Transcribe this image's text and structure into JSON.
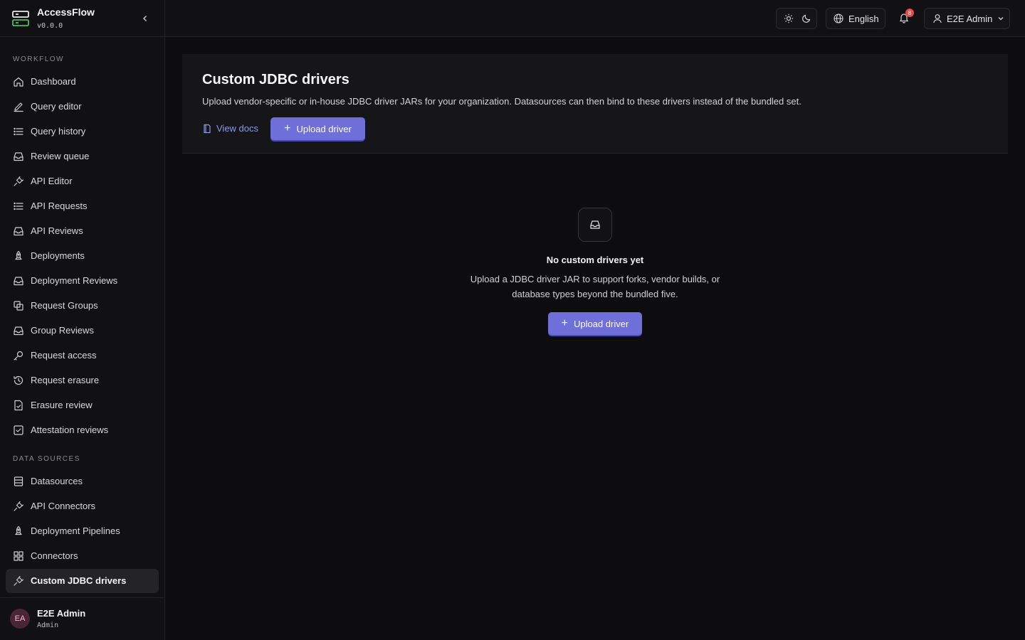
{
  "app": {
    "name": "AccessFlow",
    "version": "v0.0.0"
  },
  "sidebar": {
    "sections": [
      {
        "label": "WORKFLOW",
        "items": [
          {
            "label": "Dashboard",
            "icon": "home-icon"
          },
          {
            "label": "Query editor",
            "icon": "pencil-icon"
          },
          {
            "label": "Query history",
            "icon": "list-icon"
          },
          {
            "label": "Review queue",
            "icon": "inbox-icon"
          },
          {
            "label": "API Editor",
            "icon": "plug-icon"
          },
          {
            "label": "API Requests",
            "icon": "list-icon"
          },
          {
            "label": "API Reviews",
            "icon": "inbox-icon"
          },
          {
            "label": "Deployments",
            "icon": "rocket-icon"
          },
          {
            "label": "Deployment Reviews",
            "icon": "inbox-icon"
          },
          {
            "label": "Request Groups",
            "icon": "layers-icon"
          },
          {
            "label": "Group Reviews",
            "icon": "inbox-icon"
          },
          {
            "label": "Request access",
            "icon": "key-icon"
          },
          {
            "label": "Request erasure",
            "icon": "history-icon"
          },
          {
            "label": "Erasure review",
            "icon": "file-check-icon"
          },
          {
            "label": "Attestation reviews",
            "icon": "checkbox-icon"
          }
        ]
      },
      {
        "label": "DATA SOURCES",
        "items": [
          {
            "label": "Datasources",
            "icon": "database-icon"
          },
          {
            "label": "API Connectors",
            "icon": "plug-icon"
          },
          {
            "label": "Deployment Pipelines",
            "icon": "rocket-icon"
          },
          {
            "label": "Connectors",
            "icon": "grid-icon"
          },
          {
            "label": "Custom JDBC drivers",
            "icon": "plug-icon",
            "active": true
          }
        ]
      }
    ],
    "user": {
      "initials": "EA",
      "name": "E2E Admin",
      "role": "Admin"
    }
  },
  "header": {
    "language": "English",
    "notification_count": "8",
    "user_name": "E2E Admin"
  },
  "main": {
    "title": "Custom JDBC drivers",
    "description": "Upload vendor-specific or in-house JDBC driver JARs for your organization. Datasources can then bind to these drivers instead of the bundled set.",
    "docs_label": "View docs",
    "upload_label": "Upload driver",
    "empty": {
      "title": "No custom drivers yet",
      "description": "Upload a JDBC driver JAR to support forks, vendor builds, or database types beyond the bundled five.",
      "upload_label": "Upload driver"
    }
  },
  "colors": {
    "accent": "#6e6fd8",
    "link": "#8e96f0",
    "badge": "#e5484d"
  }
}
